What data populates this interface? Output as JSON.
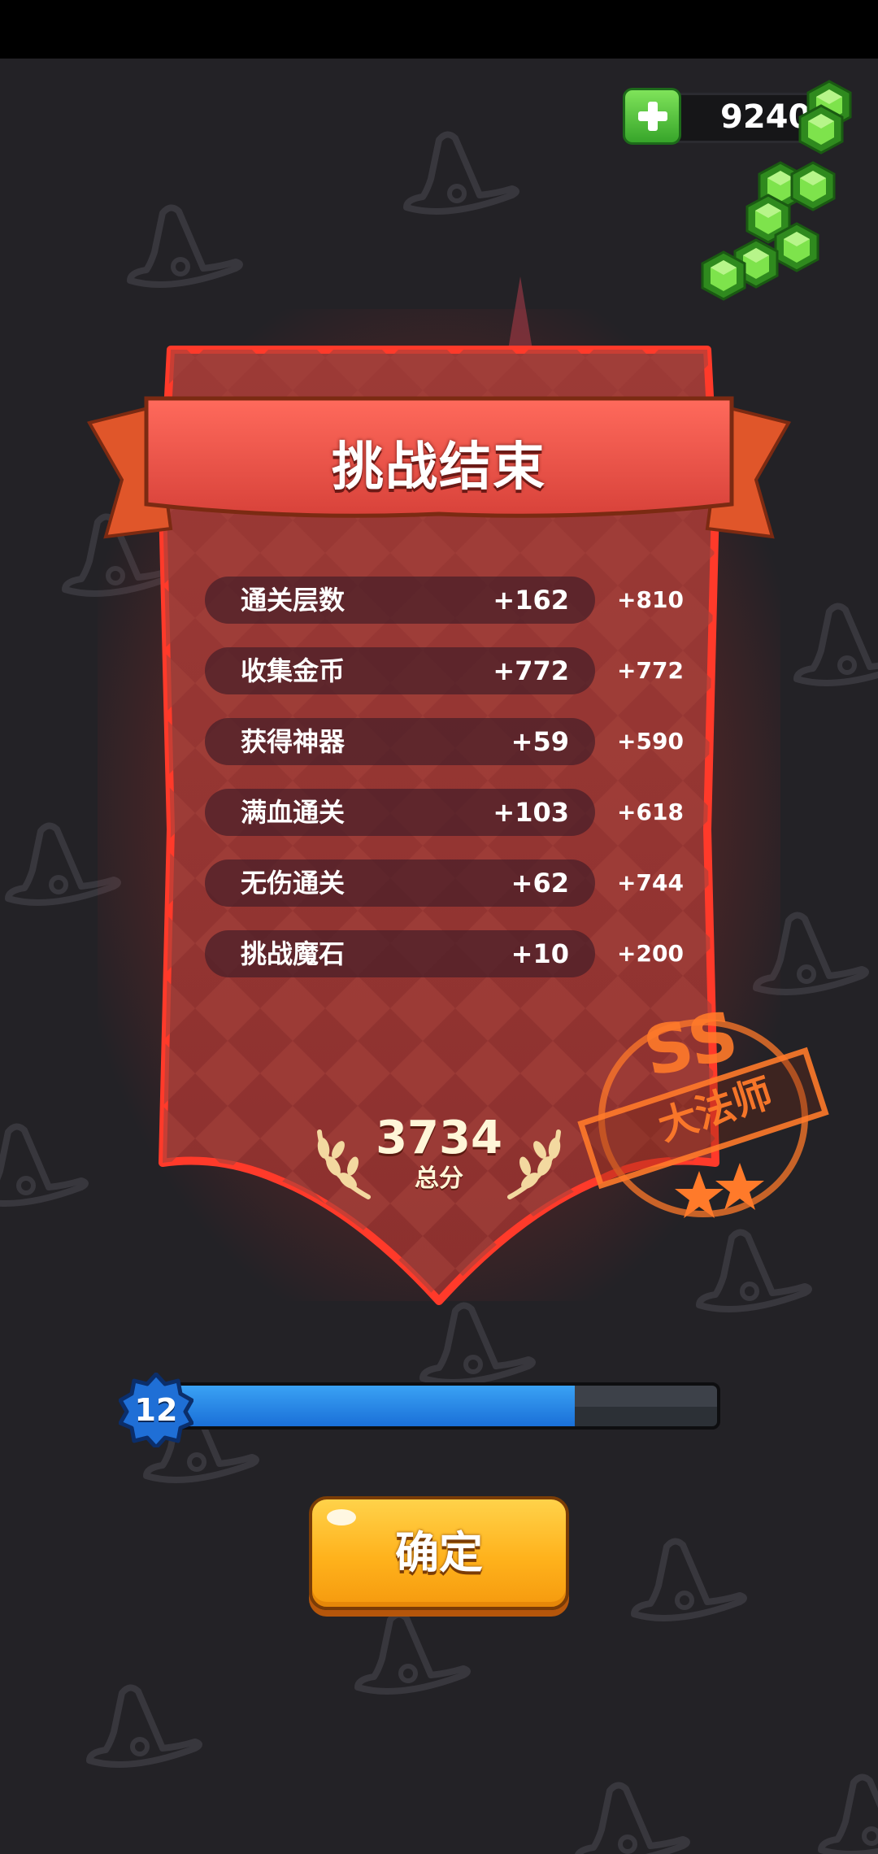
{
  "currency": {
    "amount": "9240",
    "icon": "green-gem-icon",
    "add_icon": "plus-icon"
  },
  "panel": {
    "title": "挑战结束",
    "rows": [
      {
        "label": "通关层数",
        "count": "+162",
        "score": "+810"
      },
      {
        "label": "收集金币",
        "count": "+772",
        "score": "+772"
      },
      {
        "label": "获得神器",
        "count": "+59",
        "score": "+590"
      },
      {
        "label": "满血通关",
        "count": "+103",
        "score": "+618"
      },
      {
        "label": "无伤通关",
        "count": "+62",
        "score": "+744"
      },
      {
        "label": "挑战魔石",
        "count": "+10",
        "score": "+200"
      }
    ],
    "total_value": "3734",
    "total_label": "总分"
  },
  "stamp": {
    "grade": "SS",
    "title": "大法师",
    "stars": 2
  },
  "level": {
    "number": "12",
    "progress": 0.74
  },
  "confirm_button": {
    "label": "确定"
  },
  "colors": {
    "accent_red": "#d8423a",
    "gold": "#ffb21c",
    "gem_green": "#5bd12e",
    "progress_blue": "#2a8ae8",
    "stamp_orange": "#ff7a2a"
  }
}
